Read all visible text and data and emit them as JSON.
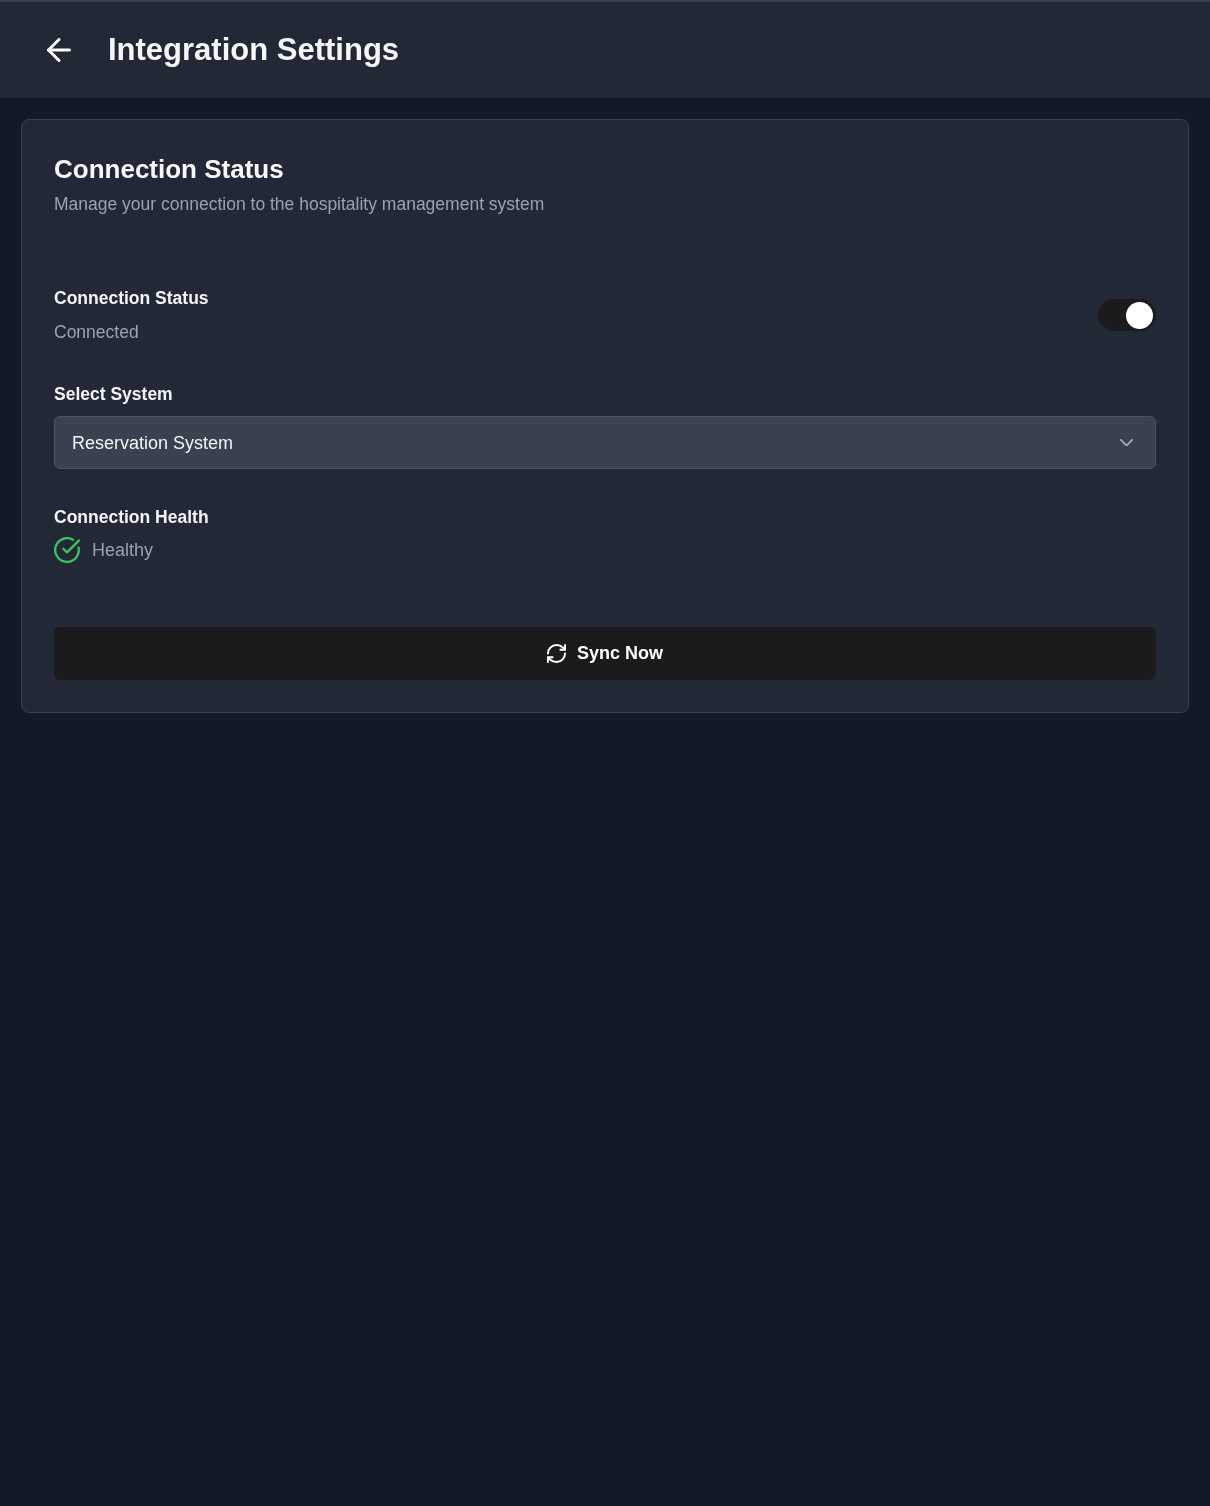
{
  "header": {
    "title": "Integration Settings"
  },
  "card": {
    "title": "Connection Status",
    "description": "Manage your connection to the hospitality management system"
  },
  "connection": {
    "label": "Connection Status",
    "status": "Connected",
    "on": true
  },
  "system_select": {
    "label": "Select System",
    "value": "Reservation System"
  },
  "health": {
    "label": "Connection Health",
    "status": "Healthy",
    "ok": true
  },
  "sync_button": {
    "label": "Sync Now"
  }
}
